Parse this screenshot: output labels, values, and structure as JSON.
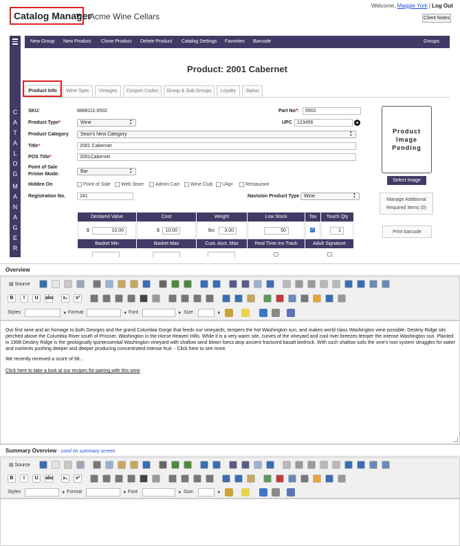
{
  "header": {
    "app_title": "Catalog Manager",
    "company": "Acme Wine Cellars",
    "welcome": "Welcome,",
    "user": "Maggie York",
    "separator": "|",
    "logout": "Log Out",
    "client_notes": "Client Notes"
  },
  "sidebar": {
    "letters_top": [
      "C",
      "A",
      "T",
      "A",
      "L",
      "O",
      "G"
    ],
    "letters_bottom": [
      "M",
      "A",
      "N",
      "A",
      "G",
      "E",
      "R"
    ]
  },
  "toolbar": {
    "items": [
      "New Group",
      "New Product",
      "Clone Product",
      "Delete Product",
      "Catalog Settings",
      "Favorites",
      "Barcode"
    ],
    "right": "Groups"
  },
  "page_title": "Product: 2001 Cabernet",
  "tabs": [
    "Product Info",
    "Wine Spec",
    "Vintages",
    "Coupon Codes",
    "Group & Sub Groups",
    "Loyalty",
    "Status"
  ],
  "form": {
    "sku_label": "SKU:",
    "sku_value": "8888111-0502",
    "product_type_label": "Product Type",
    "product_type_value": "Wine",
    "product_category_label": "Product Category",
    "product_category_value": "Sean's New Category",
    "title_label": "Title",
    "title_value": "2001 Cabernet",
    "pos_title_label": "POS Title",
    "pos_title_value": "2001Cabernet",
    "printer_mode_label_1": "Point of Sale",
    "printer_mode_label_2": "Printer Mode:",
    "printer_mode_value": "Bar",
    "hidden_on_label": "Hidden On",
    "hidden_on_options": [
      "Point of Sale",
      "Web Store",
      "Admin Cart",
      "Wine Club",
      "UApi",
      "Restaurant"
    ],
    "registration_label": "Registration No.",
    "registration_value": "241",
    "part_no_label": "Part No",
    "part_no_value": "0502",
    "upc_label": "UPC",
    "upc_value": "123456",
    "navision_label": "Navision Product Type",
    "navision_value": "Wine",
    "required_mark": "*",
    "colon": ":"
  },
  "image_panel": {
    "pending": "Product Image Pending",
    "select_image": "Select Image",
    "manage_1": "Manage Additional",
    "manage_2": "Required Items (0)",
    "print_barcode": "Print barcode"
  },
  "grid": {
    "headers": [
      "Declared Value",
      "Cost",
      "Weight",
      "Low Stock",
      "Tax",
      "Touch Qty"
    ],
    "dollar": "$",
    "lbs": "lbs",
    "declared_value": "10.00",
    "cost": "10.00",
    "weight": "3.00",
    "low_stock": "50",
    "tax_checked": true,
    "touch_qty": "1",
    "headers2": [
      "Basket Min",
      "Basket Max",
      "Cust. Acct. Max",
      "Real Time Inv Track",
      "Adult Signature"
    ]
  },
  "overview": {
    "title": "Overview",
    "source": "Source",
    "styles": "Styles",
    "format": "Format",
    "font": "Font",
    "size": "Size",
    "paragraph": "Our first wine and an homage to both Georges and the grand Columbia Gorge that feeds our vineyards, tempers the hot Washington sun, and makes world class Washington wine possible. Destiny Ridge sits perched above the Columbia River south of Prosser, Washington in the Horse Heaven Hills. While it is a very warm site, curves of the vineyard and cool river breezes temper the intense Washington sun. Planted in 1998 Destiny Ridge is the geologically quintessential Washington vineyard with shallow wind blown loess atop ancient fractured basalt bedrock. With such shallow soils the vine's root system struggles for water and nutrients pushing deeper and deeper producing concentrated intense fruit. - Click here to see more.",
    "score": "We recently received a score of 98...",
    "recipe_link": "Click here to take a look at our recipes for pairing with this wine"
  },
  "summary": {
    "title": "Summary Overview",
    "subtitle": "- used on summary screen",
    "source": "Source",
    "styles": "Styles",
    "format": "Format",
    "font": "Font",
    "size": "Size"
  },
  "colors": {
    "brand": "#3f3a66",
    "highlight": "#e02020",
    "link": "#1a4fd1"
  }
}
